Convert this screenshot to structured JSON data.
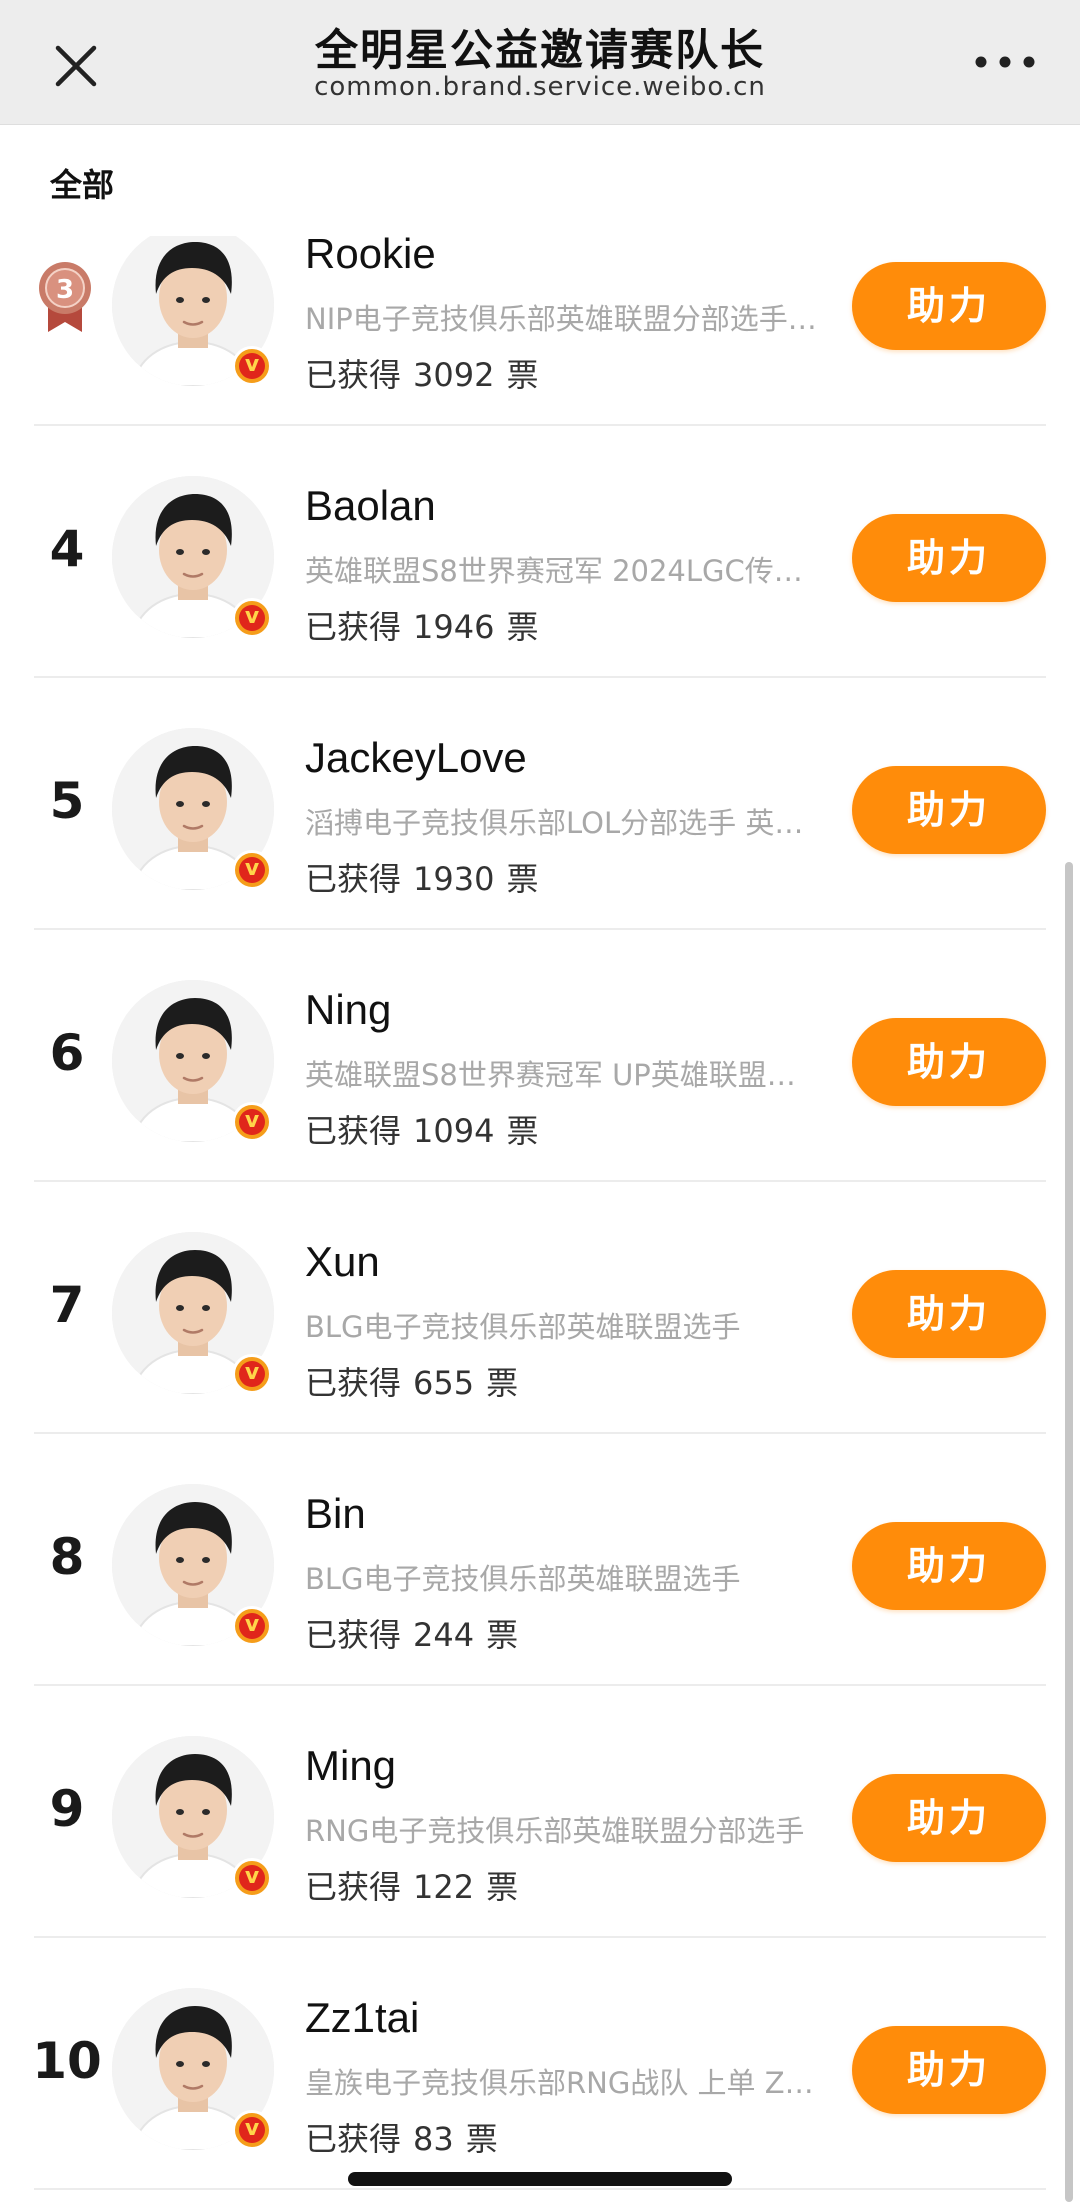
{
  "header": {
    "title": "全明星公益邀请赛队长",
    "subtitle": "common.brand.service.weibo.cn"
  },
  "filter_label": "全部",
  "list": [
    {
      "rank": "3",
      "rank_style": "bronze-medal",
      "name": "Rookie",
      "desc": "NIP电子竞技俱乐部英雄联盟分部选手…",
      "votes_prefix": "已获得",
      "votes": "3092",
      "votes_unit": "票",
      "button": "助力"
    },
    {
      "rank": "4",
      "name": "Baolan",
      "desc": "英雄联盟S8世界赛冠军 2024LGC传…",
      "votes_prefix": "已获得",
      "votes": "1946",
      "votes_unit": "票",
      "button": "助力"
    },
    {
      "rank": "5",
      "name": "JackeyLove",
      "desc": "滔搏电子竞技俱乐部LOL分部选手 英…",
      "votes_prefix": "已获得",
      "votes": "1930",
      "votes_unit": "票",
      "button": "助力"
    },
    {
      "rank": "6",
      "name": "Ning",
      "desc": "英雄联盟S8世界赛冠军 UP英雄联盟…",
      "votes_prefix": "已获得",
      "votes": "1094",
      "votes_unit": "票",
      "button": "助力"
    },
    {
      "rank": "7",
      "name": "Xun",
      "desc": "BLG电子竞技俱乐部英雄联盟选手",
      "votes_prefix": "已获得",
      "votes": "655",
      "votes_unit": "票",
      "button": "助力"
    },
    {
      "rank": "8",
      "name": "Bin",
      "desc": "BLG电子竞技俱乐部英雄联盟选手",
      "votes_prefix": "已获得",
      "votes": "244",
      "votes_unit": "票",
      "button": "助力"
    },
    {
      "rank": "9",
      "name": "Ming",
      "desc": "RNG电子竞技俱乐部英雄联盟分部选手",
      "votes_prefix": "已获得",
      "votes": "122",
      "votes_unit": "票",
      "button": "助力"
    },
    {
      "rank": "10",
      "name": "Zz1tai",
      "desc": "皇族电子竞技俱乐部RNG战队 上单 Z…",
      "votes_prefix": "已获得",
      "votes": "83",
      "votes_unit": "票",
      "button": "助力"
    }
  ],
  "badge_text": "v",
  "colors": {
    "accent": "#ff8c0a",
    "verified_outer": "#f59d1a",
    "verified_inner": "#e0261b",
    "bronze": "#c97b68"
  },
  "icons": {
    "close": "close-icon",
    "more": "more-icon",
    "verified": "verified-badge-icon",
    "medal": "bronze-medal-icon"
  }
}
